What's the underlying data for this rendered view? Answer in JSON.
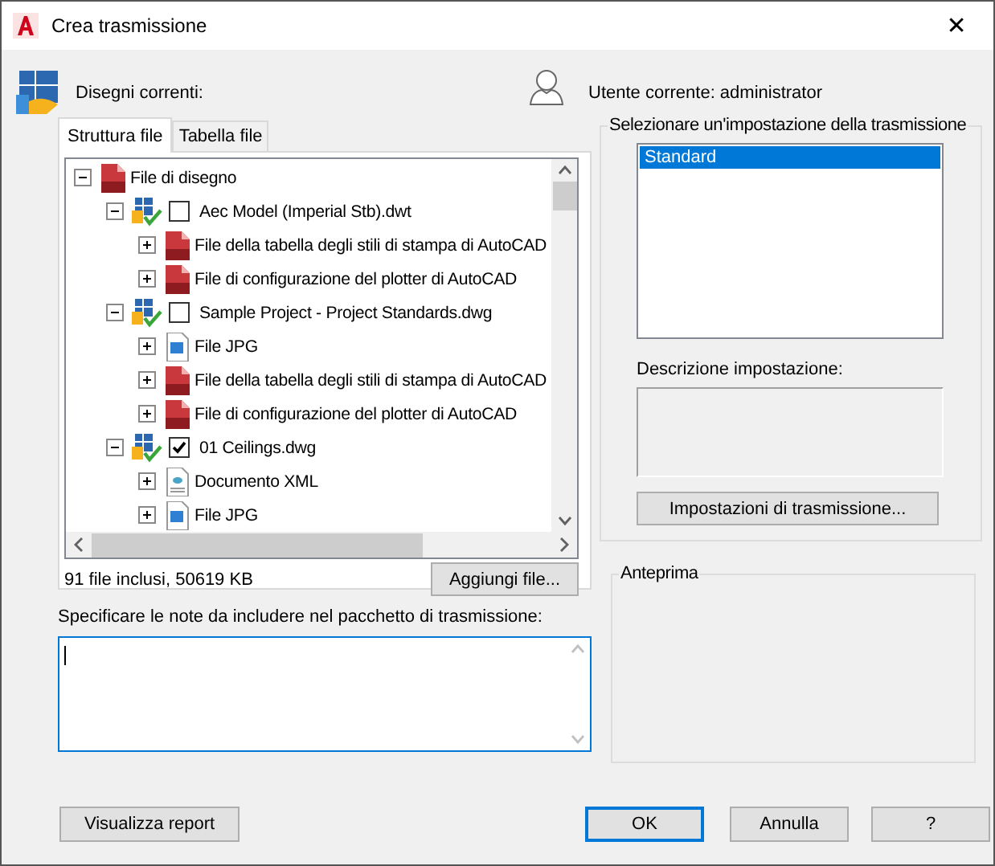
{
  "window": {
    "title": "Crea trasmissione",
    "close": "✕"
  },
  "current_drawings_label": "Disegni correnti:",
  "current_user": "Utente corrente: administrator",
  "tabs": [
    {
      "label": "Struttura file",
      "selected": true
    },
    {
      "label": "Tabella file",
      "selected": false
    }
  ],
  "tree": [
    {
      "label": "File di disegno",
      "kind": "dwt",
      "expanded": true,
      "children": [
        {
          "label": "Aec Model (Imperial Stb).dwt",
          "kind": "drawing",
          "expanded": true,
          "checked": false,
          "children": [
            {
              "label": "File della tabella degli stili di stampa di AutoCAD",
              "kind": "stb",
              "expanded": false
            },
            {
              "label": "File di configurazione del plotter di AutoCAD",
              "kind": "pc3",
              "expanded": false
            }
          ]
        },
        {
          "label": "Sample Project - Project Standards.dwg",
          "kind": "drawing",
          "expanded": true,
          "checked": false,
          "children": [
            {
              "label": "File JPG",
              "kind": "jpg",
              "expanded": false
            },
            {
              "label": "File della tabella degli stili di stampa di AutoCAD",
              "kind": "stb",
              "expanded": false
            },
            {
              "label": "File di configurazione del plotter di AutoCAD",
              "kind": "pc3",
              "expanded": false
            }
          ]
        },
        {
          "label": "01 Ceilings.dwg",
          "kind": "drawing",
          "expanded": true,
          "checked": true,
          "children": [
            {
              "label": "Documento XML",
              "kind": "xml",
              "expanded": false
            },
            {
              "label": "File JPG",
              "kind": "jpg",
              "expanded": false
            }
          ]
        }
      ]
    }
  ],
  "summary": "91 file inclusi, 50619 KB",
  "add_button": "Aggiungi file...",
  "notes_label": "Specificare le note da includere nel pacchetto di trasmissione:",
  "setup_group": {
    "title": "Selezionare un'impostazione della trasmissione",
    "items": [
      {
        "label": "Standard",
        "selected": true
      }
    ],
    "description_label": "Descrizione impostazione:",
    "button": "Impostazioni di trasmissione..."
  },
  "preview_group": {
    "title": "Anteprima"
  },
  "buttons": [
    {
      "label": "Visualizza report",
      "default": false
    },
    {
      "label": "OK",
      "default": true
    },
    {
      "label": "Annulla",
      "default": false
    },
    {
      "label": "?",
      "default": false
    }
  ]
}
